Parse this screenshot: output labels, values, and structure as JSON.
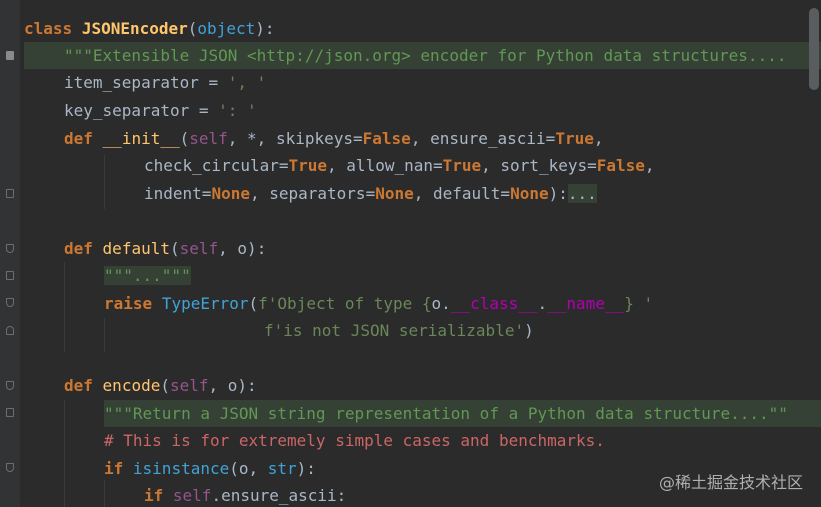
{
  "code": {
    "l1_kw": "class",
    "l1_name": "JSONEncoder",
    "l1_open": "(",
    "l1_base": "object",
    "l1_close": "):",
    "l2_doc": "\"\"\"Extensible JSON <http://json.org> encoder for Python data structures....",
    "l3_name": "item_separator",
    "l3_eq": " = ",
    "l3_val": "', '",
    "l4_name": "key_separator",
    "l4_eq": " = ",
    "l4_val": "': '",
    "l5_def": "def",
    "l5_fn": "__init__",
    "l5_open": "(",
    "l5_self": "self",
    "l5_rest1": ", *, skipkeys=",
    "l5_false1": "False",
    "l5_rest2": ", ensure_ascii=",
    "l5_true1": "True",
    "l5_rest3": ",",
    "l6_p1": "check_circular=",
    "l6_true": "True",
    "l6_p2": ", allow_nan=",
    "l6_true2": "True",
    "l6_p3": ", sort_keys=",
    "l6_false": "False",
    "l6_p4": ",",
    "l7_p1": "indent=",
    "l7_none1": "None",
    "l7_p2": ", separators=",
    "l7_none2": "None",
    "l7_p3": ", default=",
    "l7_none3": "None",
    "l7_p4": "):",
    "l7_fold": "...",
    "l9_def": "def",
    "l9_fn": "default",
    "l9_open": "(",
    "l9_self": "self",
    "l9_rest": ", o):",
    "l10_doc": "\"\"\"...\"\"\"",
    "l11_raise": "raise",
    "l11_exc": "TypeError",
    "l11_open": "(",
    "l11_f1": "f'Object of type {",
    "l11_o": "o.",
    "l11_cls": "__class__",
    "l11_dot": ".",
    "l11_name": "__name__",
    "l11_f2": "} '",
    "l12_f": "f'is not JSON serializable'",
    "l12_close": ")",
    "l14_def": "def",
    "l14_fn": "encode",
    "l14_open": "(",
    "l14_self": "self",
    "l14_rest": ", o):",
    "l15_doc": "\"\"\"Return a JSON string representation of a Python data structure....\"\"",
    "l16_cmt": "# This is for extremely simple cases and benchmarks.",
    "l17_if": "if",
    "l17_fn": "isinstance",
    "l17_rest1": "(o, ",
    "l17_str": "str",
    "l17_rest2": "):",
    "l18_if": "if",
    "l18_self": "self",
    "l18_rest": ".ensure_ascii:"
  },
  "watermark": "@稀土掘金技术社区",
  "colors": {
    "background": "#2b2b2b",
    "keyword": "#cc7832",
    "function": "#ffc66d",
    "string": "#6a8759",
    "self": "#94558d",
    "comment": "#cc6666",
    "docstring_bg": "#344134"
  }
}
